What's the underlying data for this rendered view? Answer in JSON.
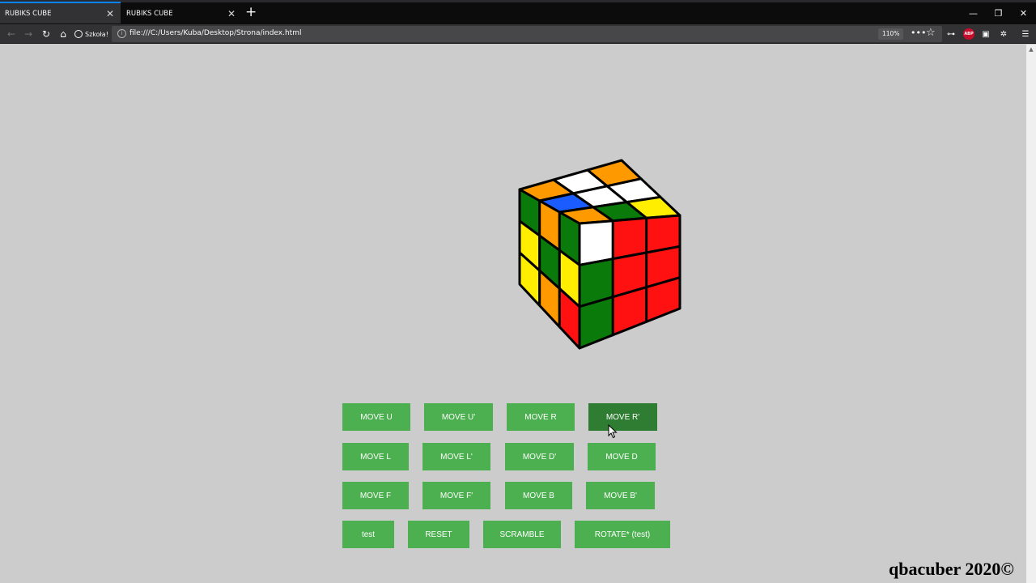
{
  "browser": {
    "tabs": [
      {
        "title": "RUBIKS CUBE",
        "active": true
      },
      {
        "title": "RUBIKS CUBE",
        "active": false
      }
    ],
    "bookmark_label": "Szkoła!",
    "url": "file:///C:/Users/Kuba/Desktop/Strona/index.html",
    "zoom": "110%"
  },
  "cube": {
    "top": [
      [
        "#ff9900",
        "#ffffff",
        "#ff9900"
      ],
      [
        "#1a5cff",
        "#ffffff",
        "#ffffff"
      ],
      [
        "#ff9900",
        "#0a7a0a",
        "#ffee00"
      ]
    ],
    "left": [
      [
        "#0a7a0a",
        "#ff9900",
        "#0a7a0a"
      ],
      [
        "#ffee00",
        "#0a7a0a",
        "#ffee00"
      ],
      [
        "#ffee00",
        "#ff9900",
        "#ff1111"
      ]
    ],
    "right": [
      [
        "#ffffff",
        "#ff1111",
        "#ff1111"
      ],
      [
        "#0a7a0a",
        "#ff1111",
        "#ff1111"
      ],
      [
        "#0a7a0a",
        "#ff1111",
        "#ff1111"
      ]
    ]
  },
  "buttons": {
    "move_u": "MOVE U",
    "move_u_prime": "MOVE U'",
    "move_r": "MOVE R",
    "move_r_prime": "MOVE R'",
    "move_l": "MOVE L",
    "move_l_prime": "MOVE L'",
    "move_d_prime": "MOVE D'",
    "move_d": "MOVE D",
    "move_f": "MOVE F",
    "move_f_prime": "MOVE F'",
    "move_b": "MOVE B",
    "move_b_prime": "MOVE B'",
    "test": "test",
    "reset": "RESET",
    "scramble": "SCRAMBLE",
    "rotate_test": "ROTATE* (test)"
  },
  "footer": "qbacuber 2020©",
  "colors": {
    "page_bg": "#cccccc",
    "button": "#4caf50",
    "button_hover": "#2e7d32"
  }
}
